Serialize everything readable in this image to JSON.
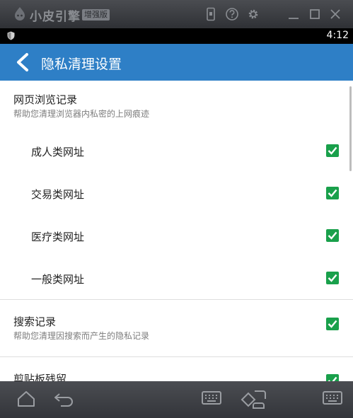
{
  "emulator": {
    "app_name": "小皮引擎",
    "edition_badge": "增强版",
    "icons": [
      "logo-icon",
      "phone-icon",
      "help-icon",
      "settings-icon",
      "minimize-icon",
      "maximize-icon",
      "close-icon"
    ]
  },
  "statusbar": {
    "time": "4:12",
    "icon": "shield-icon"
  },
  "appbar": {
    "title": "隐私清理设置",
    "back_icon": "back-arrow-icon"
  },
  "sections": [
    {
      "title": "网页浏览记录",
      "subtitle": "帮助您清理浏览器内私密的上网痕迹",
      "items": [
        {
          "label": "成人类网址",
          "checked": true
        },
        {
          "label": "交易类网址",
          "checked": true
        },
        {
          "label": "医疗类网址",
          "checked": true
        },
        {
          "label": "一般类网址",
          "checked": true
        }
      ]
    },
    {
      "title": "搜索记录",
      "subtitle": "帮助您清理因搜索而产生的隐私记录",
      "checked": true
    },
    {
      "title": "剪贴板残留",
      "checked": true
    }
  ],
  "navbar": {
    "icons": [
      "home-icon",
      "back-icon",
      "keyboard-icon",
      "rotate-icon",
      "keyboard-mapping-icon"
    ]
  },
  "colors": {
    "appbar": "#2e7fc6",
    "checkbox": "#19a04b",
    "titlebar": "#3a3c40"
  }
}
